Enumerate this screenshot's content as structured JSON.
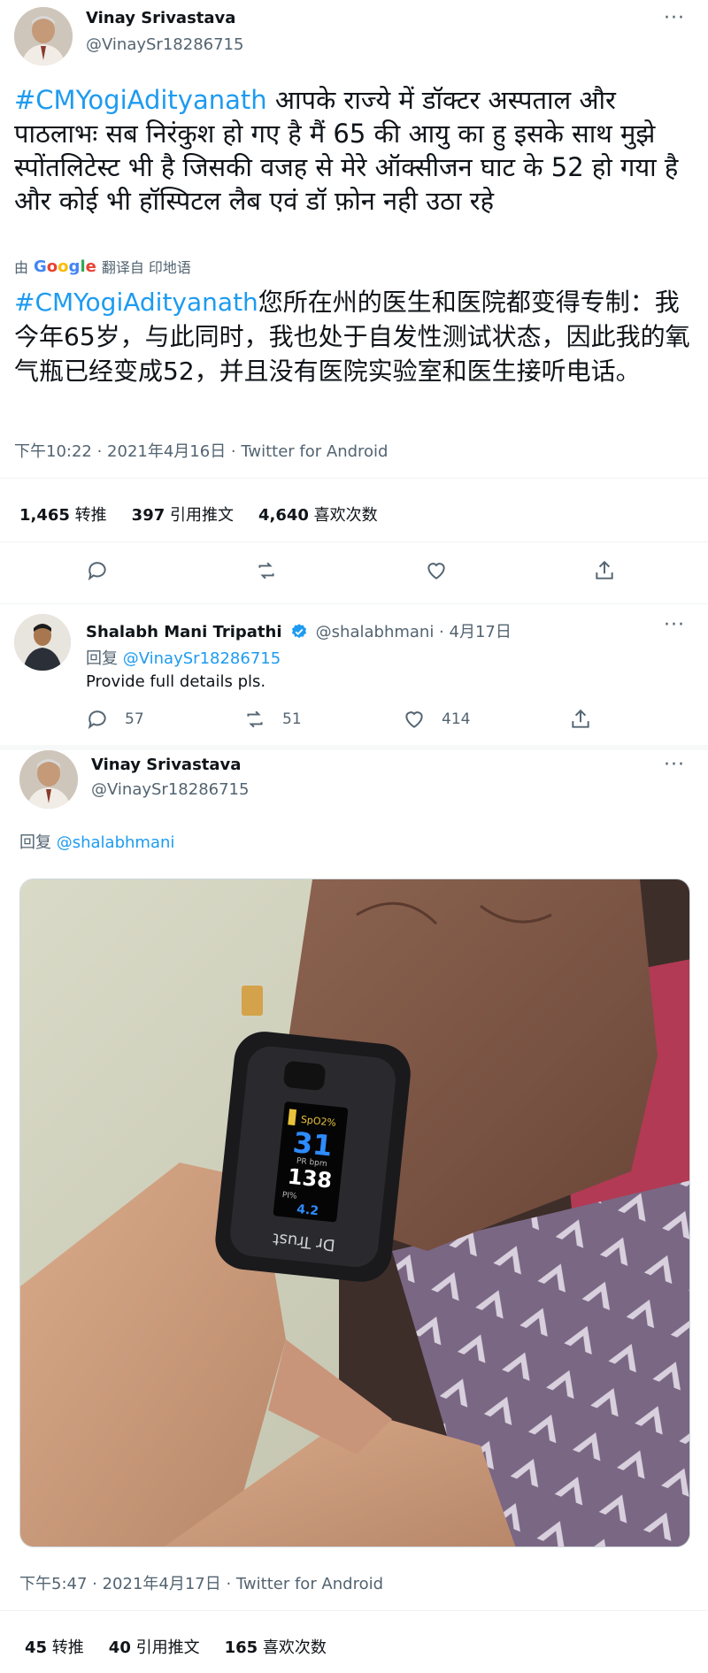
{
  "tweet1": {
    "name": "Vinay Srivastava",
    "handle": "@VinaySr18286715",
    "hashtag": "#CMYogiAdityanath",
    "text_hindi": "आपके राज्ये में डॉक्टर अस्पताल और पाठलाभः सब निरंकुश हो गए है मैं 65 की आयु का हु इसके साथ मुझे स्पोंतलिटेस्ट  भी है जिसकी वजह से मेरे ऑक्सीजन घाट के 52 हो गया है और कोई भी हॉस्पिटल लैब एवं डॉ फ़ोन नही उठा रहे",
    "translate_prefix": "由",
    "translate_brand": "Google",
    "translate_suffix": "翻译自 印地语",
    "translated_hashtag": "#CMYogiAdityanath",
    "translated_text": "您所在州的医生和医院都变得专制：我今年65岁，与此同时，我也处于自发性测试状态，因此我的氧气瓶已经变成52，并且没有医院实验室和医生接听电话。",
    "timestamp": "下午10:22 · 2021年4月16日 · Twitter for Android",
    "retweets_count": "1,465",
    "retweets_label": "转推",
    "quotes_count": "397",
    "quotes_label": "引用推文",
    "likes_count": "4,640",
    "likes_label": "喜欢次数"
  },
  "reply1": {
    "name": "Shalabh Mani Tripathi",
    "handle_date": "@shalabhmani · 4月17日",
    "reply_prefix": "回复",
    "reply_to": "@VinaySr18286715",
    "text": "Provide full details pls.",
    "comments": "57",
    "retweets": "51",
    "likes": "414"
  },
  "tweet2": {
    "name": "Vinay Srivastava",
    "handle": "@VinaySr18286715",
    "reply_prefix": "回复",
    "reply_to": "@shalabhmani",
    "oximeter": {
      "spo2_label": "SpO2%",
      "spo2": "31",
      "pr_label": "PR bpm",
      "pr": "138",
      "pi_label": "PI%",
      "pi": "4.2",
      "brand": "Dr Trust"
    },
    "timestamp": "下午5:47 · 2021年4月17日 · Twitter for Android",
    "retweets_count": "45",
    "retweets_label": "转推",
    "quotes_count": "40",
    "quotes_label": "引用推文",
    "likes_count": "165",
    "likes_label": "喜欢次数"
  },
  "colors": {
    "accent": "#1d9bf0",
    "secondary_text": "#536471",
    "divider": "#eff3f4",
    "verified": "#1d9bf0"
  }
}
